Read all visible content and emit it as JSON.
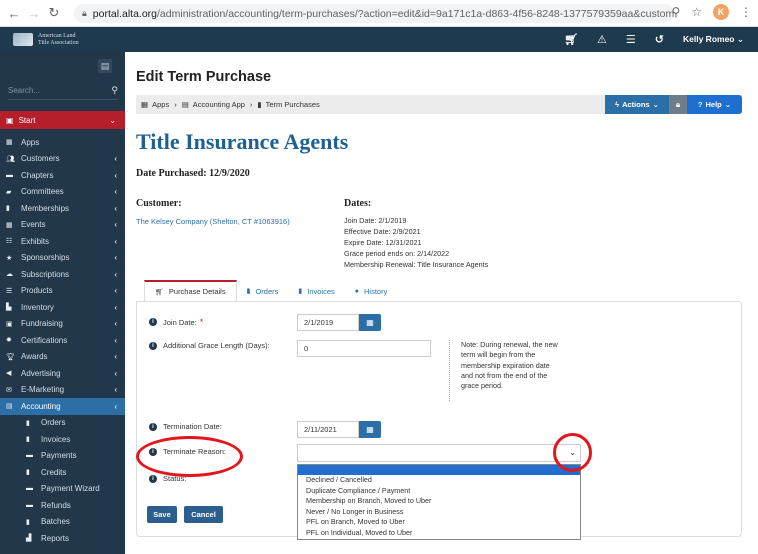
{
  "browser": {
    "url_host": "portal.alta.org",
    "url_path": "/administration/accounting/term-purchases/?action=edit&id=9a171c1a-d863-4f56-8248-1377579359aa&customerid=df...",
    "profile_initial": "K"
  },
  "header": {
    "logo_lines": [
      "American Land",
      "Title Association"
    ],
    "user_name": "Kelly Romeo"
  },
  "sidebar": {
    "search_placeholder": "Search...",
    "start_label": "Start",
    "items": [
      {
        "label": "Apps",
        "arrow": false
      },
      {
        "label": "Customers",
        "arrow": true
      },
      {
        "label": "Chapters",
        "arrow": true
      },
      {
        "label": "Committees",
        "arrow": true
      },
      {
        "label": "Memberships",
        "arrow": true
      },
      {
        "label": "Events",
        "arrow": true
      },
      {
        "label": "Exhibits",
        "arrow": true
      },
      {
        "label": "Sponsorships",
        "arrow": true
      },
      {
        "label": "Subscriptions",
        "arrow": true
      },
      {
        "label": "Products",
        "arrow": true
      },
      {
        "label": "Inventory",
        "arrow": true
      },
      {
        "label": "Fundraising",
        "arrow": true
      },
      {
        "label": "Certifications",
        "arrow": true
      },
      {
        "label": "Awards",
        "arrow": true
      },
      {
        "label": "Advertising",
        "arrow": true
      },
      {
        "label": "E-Marketing",
        "arrow": true
      },
      {
        "label": "Accounting",
        "arrow": true
      }
    ],
    "sub_items": [
      "Orders",
      "Invoices",
      "Payments",
      "Credits",
      "Payment Wizard",
      "Refunds",
      "Batches",
      "Reports"
    ]
  },
  "main": {
    "page_title": "Edit Term Purchase",
    "breadcrumb": [
      "Apps",
      "Accounting App",
      "Term Purchases"
    ],
    "actions_label": "Actions",
    "help_label": "Help",
    "heading": "Title Insurance Agents",
    "date_purchased": "Date Purchased: 12/9/2020",
    "customer_label": "Customer:",
    "customer_name": "The Kelsey Company (Shelton, CT #1063916)",
    "dates_label": "Dates:",
    "dates": [
      "Join Date: 2/1/2019",
      "Effective Date: 2/9/2021",
      "Expire Date: 12/31/2021",
      "Grace period ends on: 2/14/2022",
      "Membership Renewal: Title Insurance Agents"
    ],
    "tabs": [
      "Purchase Details",
      "Orders",
      "Invoices",
      "History"
    ]
  },
  "form": {
    "join_date_label": "Join Date:",
    "join_date_value": "2/1/2019",
    "grace_label": "Additional Grace Length (Days):",
    "grace_value": "0",
    "note_lines": [
      "Note: During renewal, the new",
      "term will begin from the",
      "membership expiration date",
      "and not from the end of the",
      "grace period."
    ],
    "termination_date_label": "Termination Date:",
    "termination_date_value": "2/11/2021",
    "terminate_reason_label": "Terminate Reason:",
    "status_label": "Status:",
    "reason_options": [
      "Declined / Cancelled",
      "Duplicate Compliance / Payment",
      "Membership on Branch, Moved to Uber",
      "Never / No Longer in Business",
      "PFL on Branch, Moved to Uber",
      "PFL on Individual, Moved to Uber"
    ],
    "save_label": "Save",
    "cancel_label": "Cancel"
  },
  "colors": {
    "sidebar_bg": "#22384a",
    "header_bg": "#1e3a4f",
    "accent_blue": "#2c6fa7",
    "start_red": "#b51f2c",
    "annotation_red": "#e3141b"
  }
}
